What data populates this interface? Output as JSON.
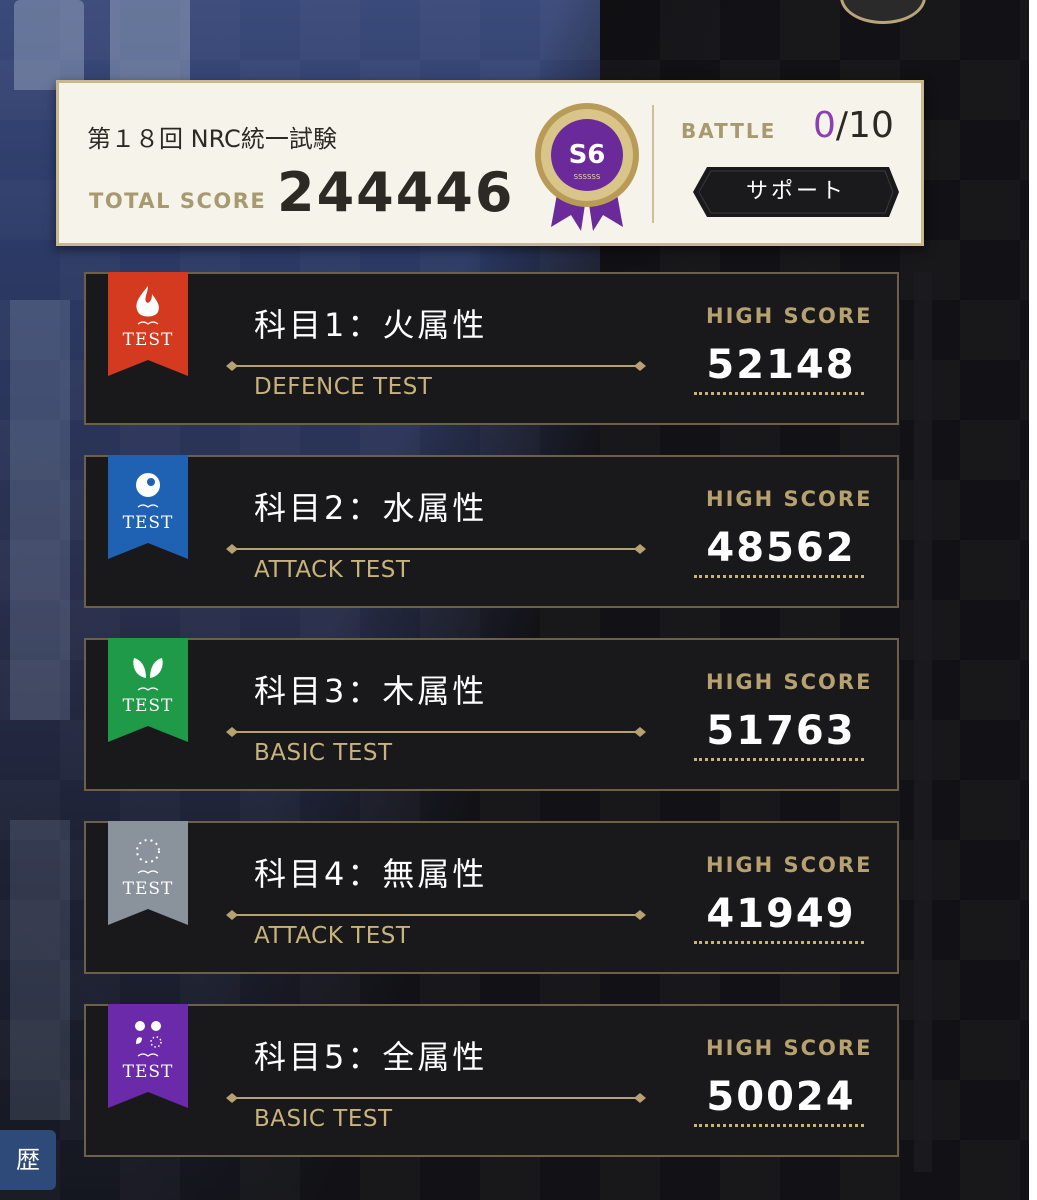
{
  "header": {
    "title": "第１８回 NRC統一試験",
    "total_score_label": "TOTAL SCORE",
    "total_score_value": "244446",
    "rank_badge": {
      "rank": "S6",
      "sub": "SSSSSS",
      "color": "#6a2a9a"
    },
    "battle_label": "BATTLE",
    "battle_current": "0",
    "battle_max": "/10",
    "support_button": "サポート"
  },
  "subjects": [
    {
      "subject": "科目1：火属性",
      "test": "DEFENCE TEST",
      "hs_label": "HIGH SCORE",
      "high_score": "52148",
      "ribbon_label": "TEST",
      "ribbon_color": "#d33a1f",
      "icon": "fire-icon"
    },
    {
      "subject": "科目2：水属性",
      "test": "ATTACK TEST",
      "hs_label": "HIGH SCORE",
      "high_score": "48562",
      "ribbon_label": "TEST",
      "ribbon_color": "#1f62b3",
      "icon": "water-icon"
    },
    {
      "subject": "科目3：木属性",
      "test": "BASIC TEST",
      "hs_label": "HIGH SCORE",
      "high_score": "51763",
      "ribbon_label": "TEST",
      "ribbon_color": "#1f9a48",
      "icon": "leaf-icon"
    },
    {
      "subject": "科目4：無属性",
      "test": "ATTACK TEST",
      "hs_label": "HIGH SCORE",
      "high_score": "41949",
      "ribbon_label": "TEST",
      "ribbon_color": "#8a929c",
      "icon": "dotted-circle-icon"
    },
    {
      "subject": "科目5：全属性",
      "test": "BASIC TEST",
      "hs_label": "HIGH SCORE",
      "high_score": "50024",
      "ribbon_label": "TEST",
      "ribbon_color": "#6a2aaa",
      "icon": "all-elements-icon"
    }
  ],
  "history_tab": "歴"
}
